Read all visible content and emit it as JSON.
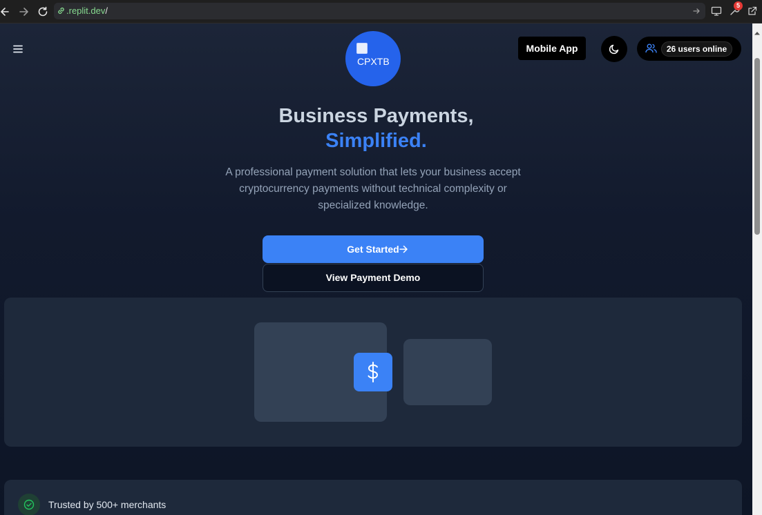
{
  "browser": {
    "url_domain": ".replit.dev",
    "url_path": "/",
    "extensions_badge": "5"
  },
  "header": {
    "logo_alt": "CPXTB",
    "mobile_app_label": "Mobile App",
    "users_online": "26 users online"
  },
  "hero": {
    "title_line1": "Business Payments,",
    "title_line2": "Simplified.",
    "description": "A professional payment solution that lets your business accept cryptocurrency payments without technical complexity or specialized knowledge.",
    "primary_cta": "Get Started",
    "secondary_cta": "View Payment Demo"
  },
  "trust": {
    "text": "Trusted by 500+ merchants"
  },
  "colors": {
    "accent": "#3b82f6",
    "logo_bg": "#2563eb",
    "success": "#22c55e"
  },
  "icons": [
    "back-arrow-icon",
    "forward-arrow-icon",
    "reload-icon",
    "link-icon",
    "menu-icon",
    "moon-icon",
    "users-icon",
    "arrow-right-icon",
    "dollar-icon",
    "check-circle-icon"
  ]
}
